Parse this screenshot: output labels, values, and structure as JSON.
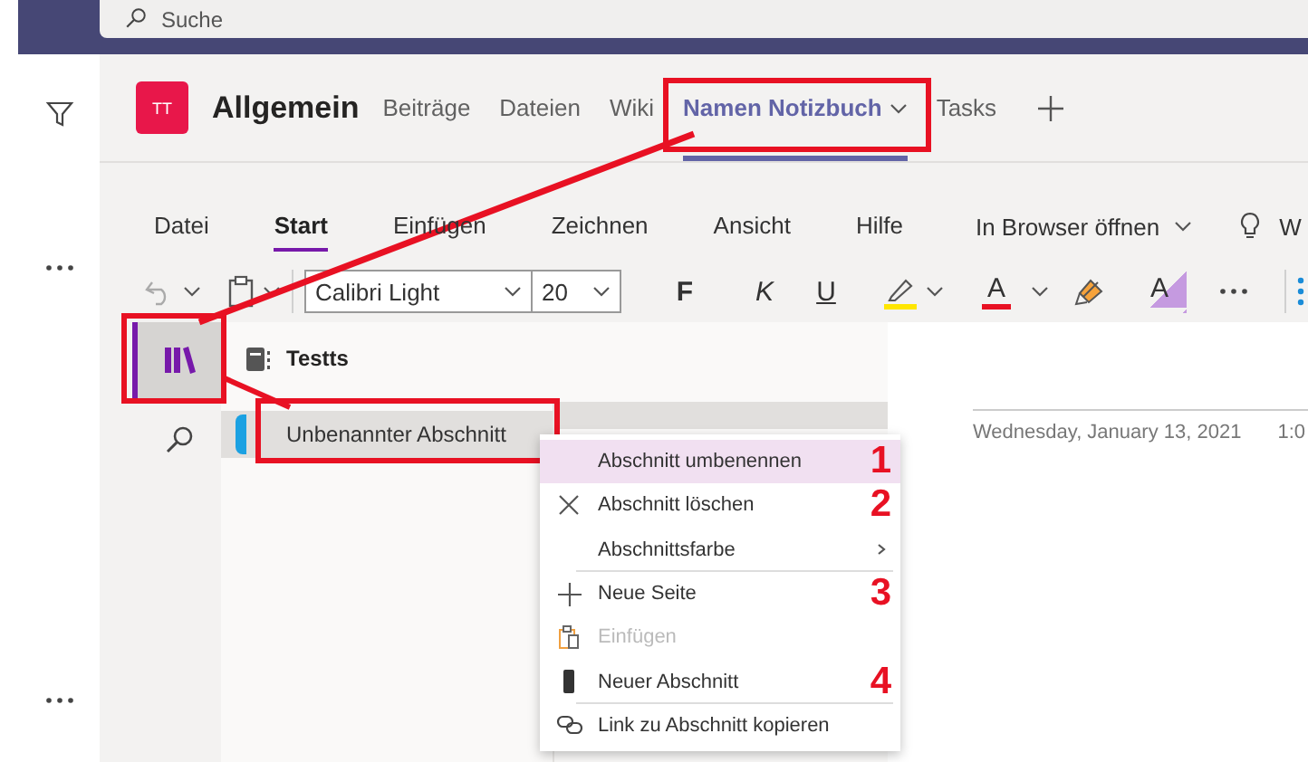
{
  "search": {
    "placeholder": "Suche"
  },
  "team": {
    "initials": "TT",
    "name": "Allgemein"
  },
  "channel_tabs": [
    {
      "label": "Beiträge",
      "selected": false,
      "dropdown": false,
      "marked": false
    },
    {
      "label": "Dateien",
      "selected": false,
      "dropdown": false,
      "marked": false
    },
    {
      "label": "Wiki",
      "selected": false,
      "dropdown": false,
      "marked": false
    },
    {
      "label": "Namen Notizbuch",
      "selected": true,
      "dropdown": true,
      "marked": true
    },
    {
      "label": "Tasks",
      "selected": false,
      "dropdown": false,
      "marked": false
    }
  ],
  "ribbon_tabs": [
    {
      "label": "Datei",
      "selected": false
    },
    {
      "label": "Start",
      "selected": true
    },
    {
      "label": "Einfügen",
      "selected": false
    },
    {
      "label": "Zeichnen",
      "selected": false
    },
    {
      "label": "Ansicht",
      "selected": false
    },
    {
      "label": "Hilfe",
      "selected": false
    }
  ],
  "open_in_browser": "In Browser öffnen",
  "tell_me": "W",
  "toolbar": {
    "font": "Calibri Light",
    "size": "20",
    "bold": "F",
    "italic": "K",
    "underline": "U",
    "font_color": "A",
    "clear_format": "A"
  },
  "nav": [
    {
      "kind": "notebooks",
      "selected": true,
      "marked": true
    },
    {
      "kind": "search",
      "selected": false,
      "marked": false
    }
  ],
  "notebook": {
    "name": "Testts"
  },
  "sections": [
    {
      "label": "Unbenannter Abschnitt",
      "selected": true,
      "marked": true,
      "color": "#1ba1e2"
    }
  ],
  "page": {
    "date": "Wednesday, January 13, 2021",
    "time": "1:0"
  },
  "context_menu": [
    {
      "kind": "plain",
      "label": "Abschnitt umbenennen",
      "highlighted": true,
      "disabled": false,
      "divider_after": false,
      "callout": "1"
    },
    {
      "kind": "delete",
      "label": "Abschnitt löschen",
      "highlighted": false,
      "disabled": false,
      "divider_after": false,
      "callout": "2"
    },
    {
      "kind": "submenu",
      "label": "Abschnittsfarbe",
      "highlighted": false,
      "disabled": false,
      "divider_after": true
    },
    {
      "kind": "new-page",
      "label": "Neue Seite",
      "highlighted": false,
      "disabled": false,
      "divider_after": false,
      "callout": "3"
    },
    {
      "kind": "paste",
      "label": "Einfügen",
      "highlighted": false,
      "disabled": true,
      "divider_after": false
    },
    {
      "kind": "new-section",
      "label": "Neuer Abschnitt",
      "highlighted": false,
      "disabled": false,
      "divider_after": true,
      "callout": "4"
    },
    {
      "kind": "link",
      "label": "Link zu Abschnitt kopieren",
      "highlighted": false,
      "disabled": false,
      "divider_after": false
    }
  ]
}
